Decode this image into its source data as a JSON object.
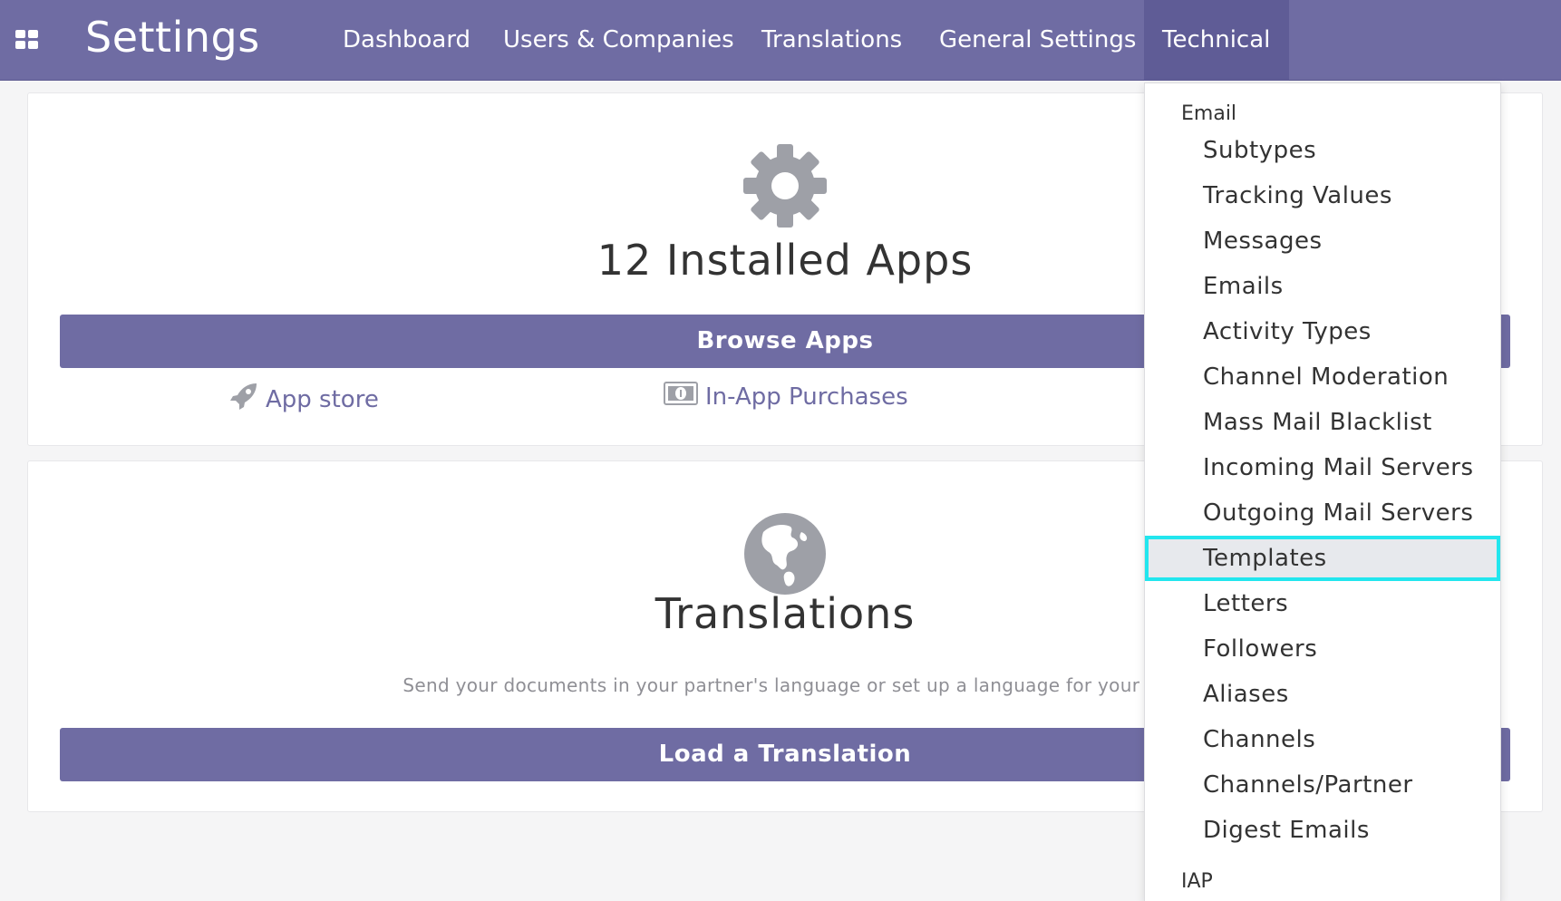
{
  "header": {
    "app_title": "Settings",
    "apps_icon": "grid-icon",
    "nav": [
      {
        "label": "Dashboard"
      },
      {
        "label": "Users & Companies"
      },
      {
        "label": "Translations"
      },
      {
        "label": "General Settings"
      },
      {
        "label": "Technical"
      }
    ]
  },
  "apps_card": {
    "icon": "gear-icon",
    "title": "12 Installed Apps",
    "button": "Browse Apps",
    "links": [
      {
        "label": "App store",
        "icon": "rocket-icon"
      },
      {
        "label": "In-App Purchases",
        "icon": "money-icon"
      }
    ]
  },
  "translations_card": {
    "icon": "globe-icon",
    "title": "Translations",
    "description": "Send your documents in your partner's language or set up a language for your us",
    "button": "Load a Translation"
  },
  "technical_menu": {
    "section_email": "Email",
    "items": [
      {
        "label": "Subtypes"
      },
      {
        "label": "Tracking Values"
      },
      {
        "label": "Messages"
      },
      {
        "label": "Emails"
      },
      {
        "label": "Activity Types"
      },
      {
        "label": "Channel Moderation"
      },
      {
        "label": "Mass Mail Blacklist"
      },
      {
        "label": "Incoming Mail Servers"
      },
      {
        "label": "Outgoing Mail Servers"
      },
      {
        "label": "Templates"
      },
      {
        "label": "Letters"
      },
      {
        "label": "Followers"
      },
      {
        "label": "Aliases"
      },
      {
        "label": "Channels"
      },
      {
        "label": "Channels/Partner"
      },
      {
        "label": "Digest Emails"
      }
    ],
    "section_iap": "IAP",
    "highlighted_item": "Templates"
  },
  "colors": {
    "brand": "#6f6ca3",
    "highlight_outline": "#22e6ee"
  }
}
